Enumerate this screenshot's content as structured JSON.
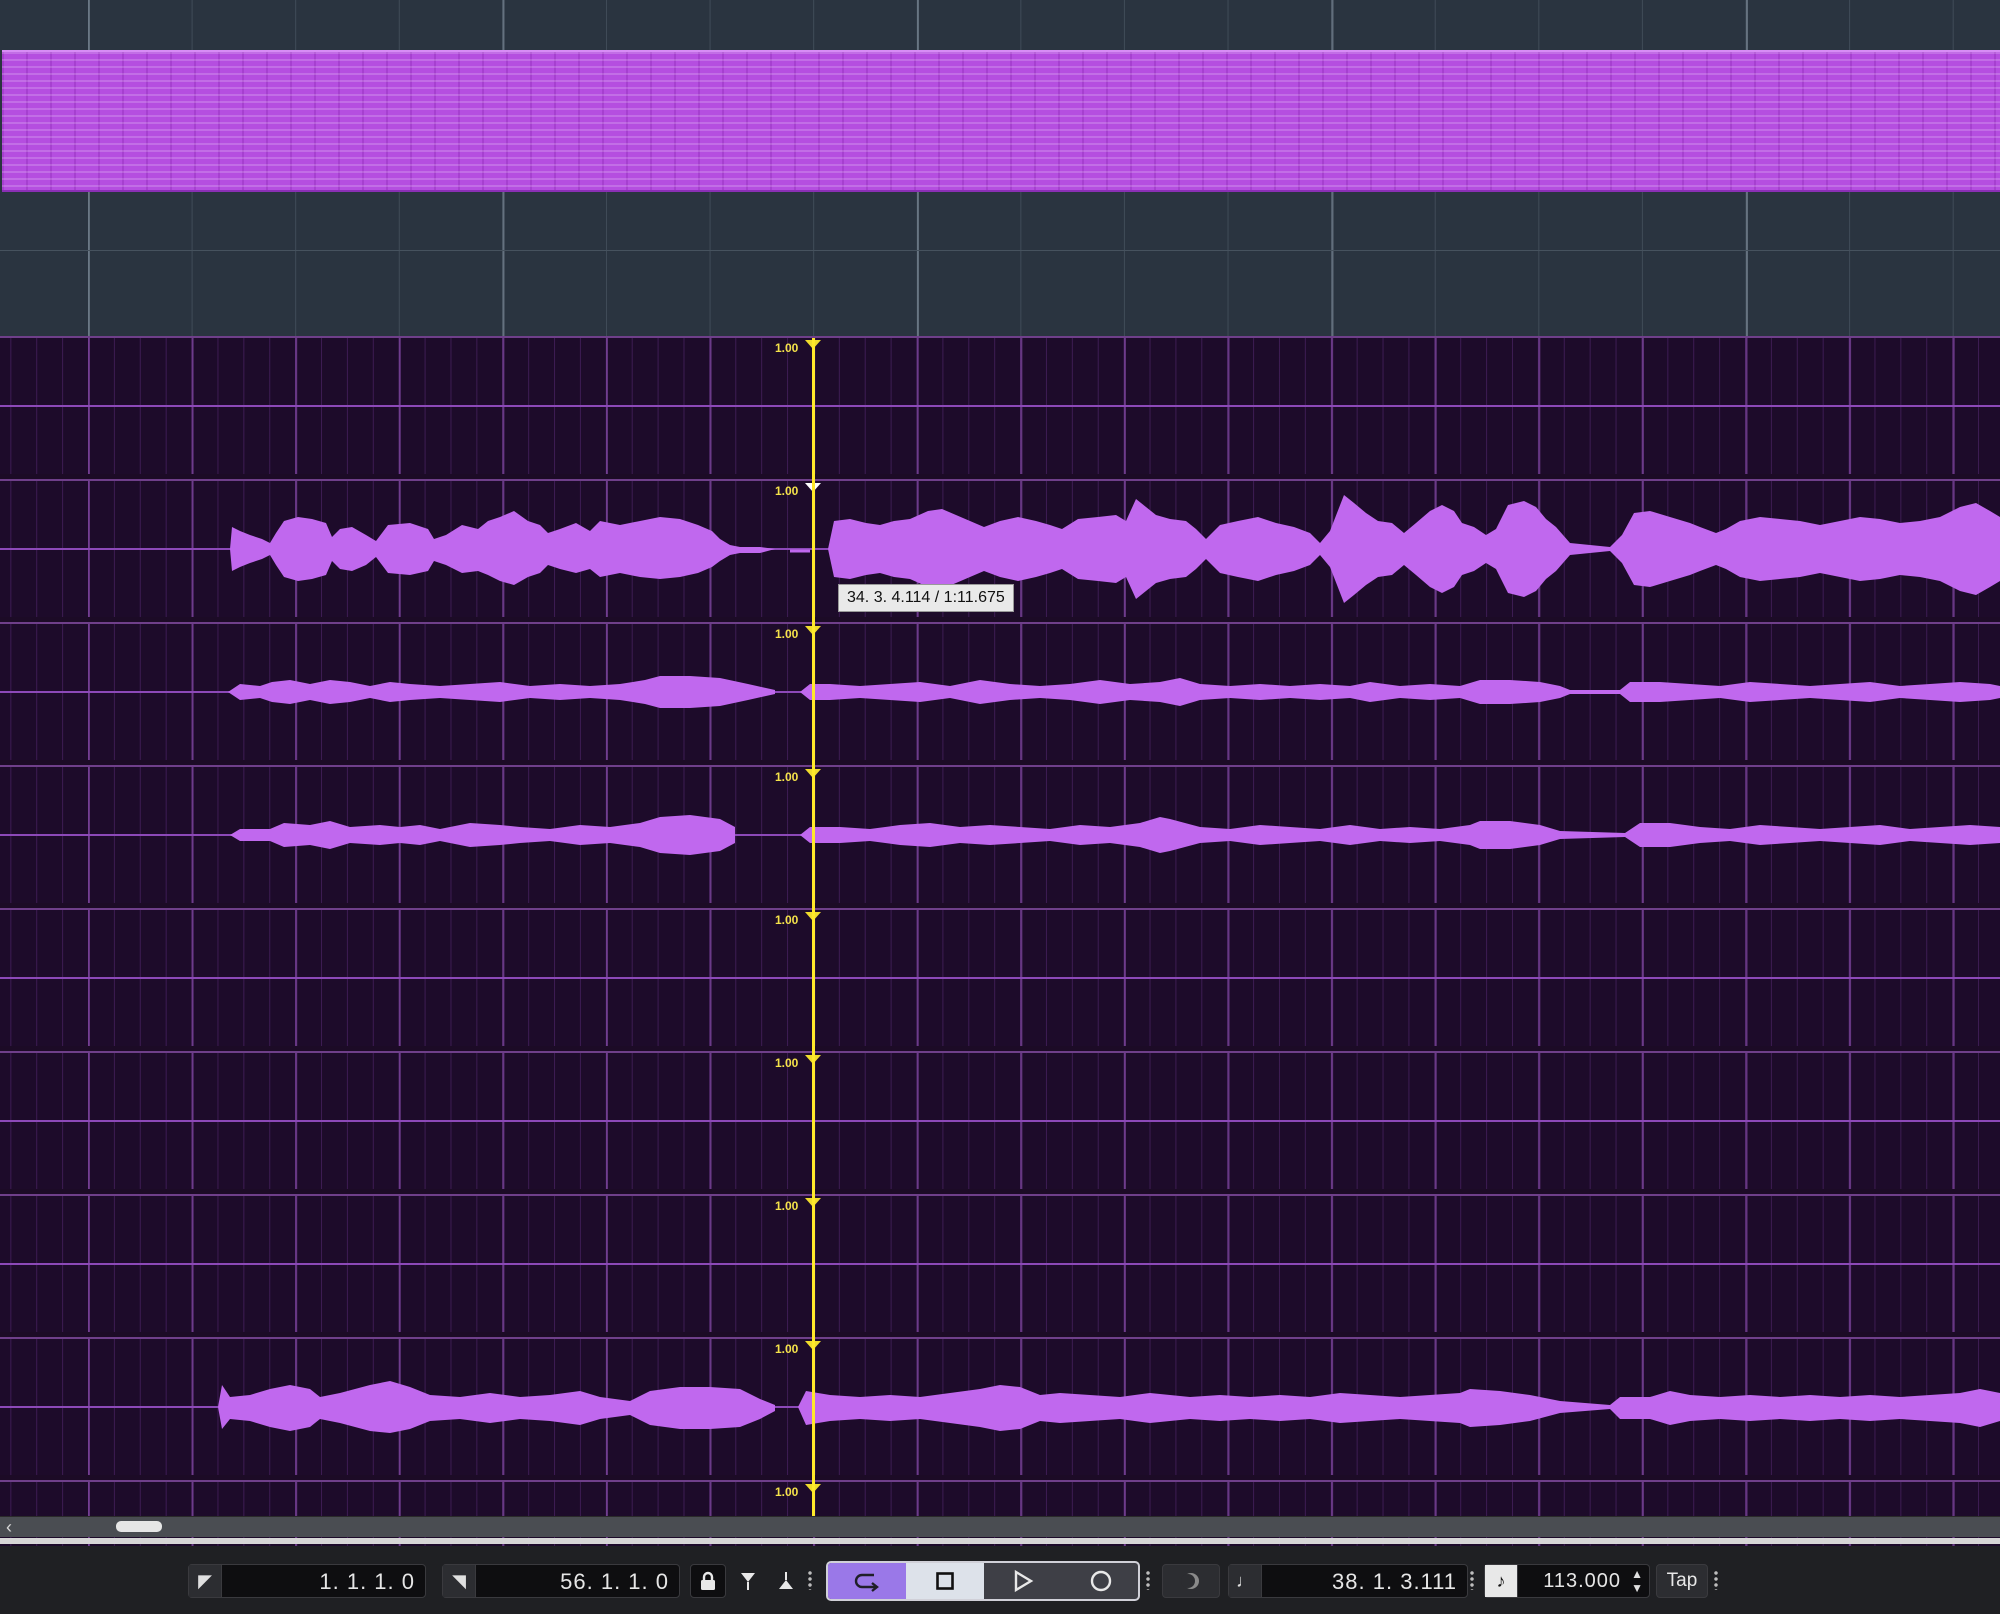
{
  "window": {
    "title": ""
  },
  "ruler_levels": [
    "1.00",
    "1.00",
    "1.00",
    "1.00",
    "1.00",
    "1.00",
    "1.00",
    "1.00",
    "1.00"
  ],
  "tooltip": {
    "text": "34. 3. 4.114 / 1:11.675"
  },
  "transport": {
    "left_locator": "1. 1. 1.   0",
    "right_locator": "56. 1. 1.   0",
    "position": "38.  1.  3.111",
    "tempo": "113.000",
    "tap_label": "Tap",
    "icons": {
      "left_locator": "left-locator-icon",
      "right_locator": "right-locator-icon",
      "lock": "lock-icon",
      "punch_in": "punch-in-icon",
      "punch_out": "punch-out-icon",
      "cycle": "cycle-icon",
      "stop": "stop-icon",
      "play": "play-icon",
      "record": "record-icon",
      "metronome_off": "click-icon",
      "note": "note-icon",
      "tempo_track": "tempo-track-icon"
    }
  },
  "colors": {
    "clip": "#b54ee0",
    "waveform": "#c068ee",
    "cursor": "#ffe92a",
    "lane_bg": "#1d0b2a",
    "grid_bg": "#2a3440"
  }
}
